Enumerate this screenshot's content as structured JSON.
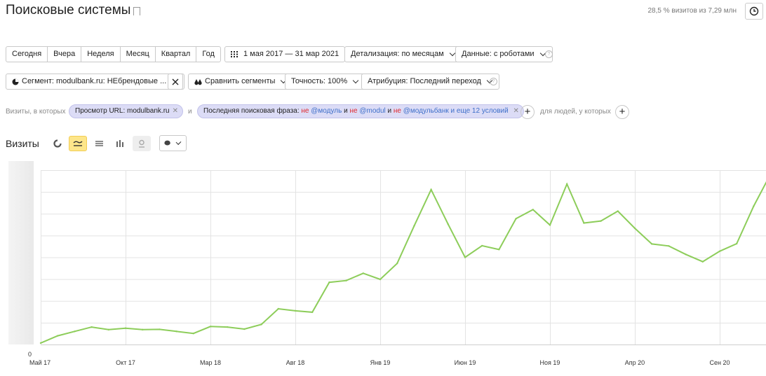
{
  "header": {
    "title": "Поисковые системы",
    "sample_info": "28,5 % визитов из 7,29 млн"
  },
  "period_buttons": [
    "Сегодня",
    "Вчера",
    "Неделя",
    "Месяц",
    "Квартал",
    "Год"
  ],
  "date_range": "1 мая 2017 — 31 мар 2021",
  "detalization": "Детализация: по месяцам",
  "data_mode": "Данные: с роботами",
  "segment": {
    "label": "Сегмент: modulbank.ru: НЕбрендовые ...",
    "compare": "Сравнить сегменты",
    "accuracy": "Точность: 100%",
    "attribution": "Атрибуция: Последний переход"
  },
  "filters": {
    "prefix": "Визиты, в которых",
    "chip1": "Просмотр URL: modulbank.ru",
    "and": "и",
    "chip2_label": "Последняя поисковая фраза:",
    "ne1": "не",
    "term1": "@модуль",
    "and1": "и",
    "ne2": "не",
    "term2": "@modul",
    "and2": "и",
    "ne3": "не",
    "term3": "@модульбанк",
    "more": "и еще 12 условий",
    "suffix": "для людей, у которых"
  },
  "visits": {
    "title": "Визиты"
  },
  "chart_data": {
    "type": "line",
    "x": [
      "2017-05",
      "2017-06",
      "2017-07",
      "2017-08",
      "2017-09",
      "2017-10",
      "2017-11",
      "2017-12",
      "2018-01",
      "2018-02",
      "2018-03",
      "2018-04",
      "2018-05",
      "2018-06",
      "2018-07",
      "2018-08",
      "2018-09",
      "2018-10",
      "2018-11",
      "2018-12",
      "2019-01",
      "2019-02",
      "2019-03",
      "2019-04",
      "2019-05",
      "2019-06",
      "2019-07",
      "2019-08",
      "2019-09",
      "2019-10",
      "2019-11",
      "2019-12",
      "2020-01",
      "2020-02",
      "2020-03",
      "2020-04",
      "2020-05",
      "2020-06",
      "2020-07",
      "2020-08",
      "2020-09",
      "2020-10",
      "2020-11",
      "2020-12"
    ],
    "values": [
      0.5,
      3,
      4.5,
      6,
      5.1,
      5.6,
      5.1,
      5.2,
      4.5,
      3.8,
      6.2,
      6.0,
      5.3,
      6.9,
      12.3,
      11.6,
      11.1,
      21.4,
      22.0,
      24.5,
      22.4,
      27.9,
      40.8,
      53.3,
      41.4,
      30.0,
      34.0,
      32.7,
      43.3,
      46.4,
      41.1,
      55.2,
      41.8,
      42.5,
      45.9,
      40.0,
      34.6,
      33.9,
      31.0,
      28.5,
      32.1,
      34.7,
      47.6,
      58.7
    ],
    "ylim": [
      0,
      60
    ],
    "x_tick_labels": [
      "Май 17",
      "Окт 17",
      "Мар 18",
      "Авг 18",
      "Янв 19",
      "Июн 19",
      "Ноя 19",
      "Апр 20",
      "Сен 20"
    ],
    "y_zero_label": "0",
    "grid": true,
    "color": "#8dcd5a"
  }
}
